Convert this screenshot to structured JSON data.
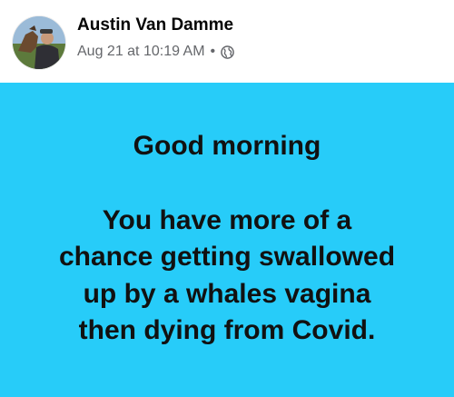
{
  "post": {
    "author": "Austin Van Damme",
    "timestamp": "Aug 21 at 10:19 AM",
    "separator": "•",
    "privacy_icon": "globe-icon",
    "background_color": "#27ccf9",
    "text_lines": [
      "Good morning",
      "You have more of a",
      "chance getting swallowed",
      "up by a whales vagina",
      "then dying from Covid."
    ]
  }
}
